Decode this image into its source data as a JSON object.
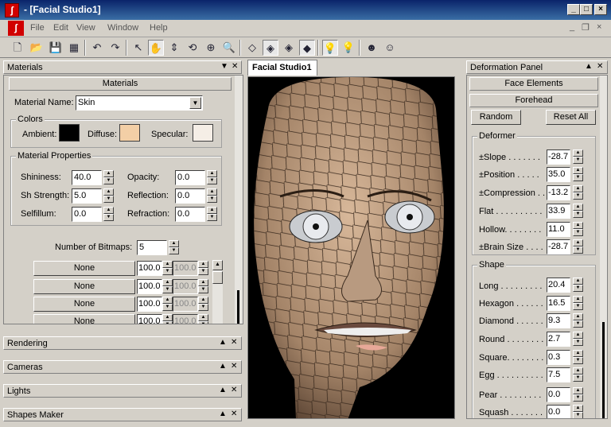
{
  "window": {
    "title": "- [Facial Studio1]",
    "icon": "app-icon"
  },
  "menu": {
    "items": [
      "File",
      "Edit",
      "View",
      "Window",
      "Help"
    ]
  },
  "left_panel": {
    "title": "Materials",
    "section": "Materials",
    "material_name_label": "Material Name:",
    "material_name_value": "Skin",
    "colors": {
      "title": "Colors",
      "ambient": "Ambient:",
      "diffuse": "Diffuse:",
      "specular": "Specular:",
      "ambient_color": "#000000",
      "diffuse_color": "#f3cfa6",
      "specular_color": "#f5eee6"
    },
    "properties": {
      "title": "Material Properties",
      "shininess": {
        "label": "Shininess:",
        "value": "40.0"
      },
      "sh_strength": {
        "label": "Sh Strength:",
        "value": "5.0"
      },
      "selfillum": {
        "label": "Selfillum:",
        "value": "0.0"
      },
      "opacity": {
        "label": "Opacity:",
        "value": "0.0"
      },
      "reflection": {
        "label": "Reflection:",
        "value": "0.0"
      },
      "refraction": {
        "label": "Refraction:",
        "value": "0.0"
      }
    },
    "bitmaps_label": "Number of Bitmaps:",
    "bitmaps_value": "5",
    "bitmap_rows": [
      {
        "name": "None",
        "amount": "100.0",
        "dim": "100.0"
      },
      {
        "name": "None",
        "amount": "100.0",
        "dim": "100.0"
      },
      {
        "name": "None",
        "amount": "100.0",
        "dim": "100.0"
      },
      {
        "name": "None",
        "amount": "100.0",
        "dim": "100.0"
      }
    ],
    "collapsed": [
      "Rendering",
      "Cameras",
      "Lights",
      "Shapes Maker"
    ]
  },
  "viewport": {
    "tab": "Facial Studio1"
  },
  "right_panel": {
    "title": "Deformation Panel",
    "face_elements": "Face Elements",
    "forehead": "Forehead",
    "random": "Random",
    "reset_all": "Reset All",
    "deformer": {
      "title": "Deformer",
      "rows": [
        {
          "label": "±Slope . . . . . . .",
          "value": "-28.7"
        },
        {
          "label": "±Position . . . . .",
          "value": "35.0"
        },
        {
          "label": "±Compression . .",
          "value": "-13.2"
        },
        {
          "label": "Flat . . . . . . . . . .",
          "value": "33.9"
        },
        {
          "label": "Hollow. . . . . . . .",
          "value": "11.0"
        },
        {
          "label": "±Brain Size . . . .",
          "value": "-28.7"
        }
      ]
    },
    "shape": {
      "title": "Shape",
      "rows": [
        {
          "label": "Long . . . . . . . . .",
          "value": "20.4"
        },
        {
          "label": "Hexagon . . . . . .",
          "value": "16.5"
        },
        {
          "label": "Diamond . . . . . .",
          "value": "9.3"
        },
        {
          "label": "Round . . . . . . . .",
          "value": "2.7"
        },
        {
          "label": "Square. . . . . . . .",
          "value": "0.3"
        },
        {
          "label": "Egg . . . . . . . . . .",
          "value": "7.5"
        },
        {
          "label": "Pear . . . . . . . . .",
          "value": "0.0"
        },
        {
          "label": "Squash . . . . . . .",
          "value": "0.0"
        }
      ]
    }
  }
}
